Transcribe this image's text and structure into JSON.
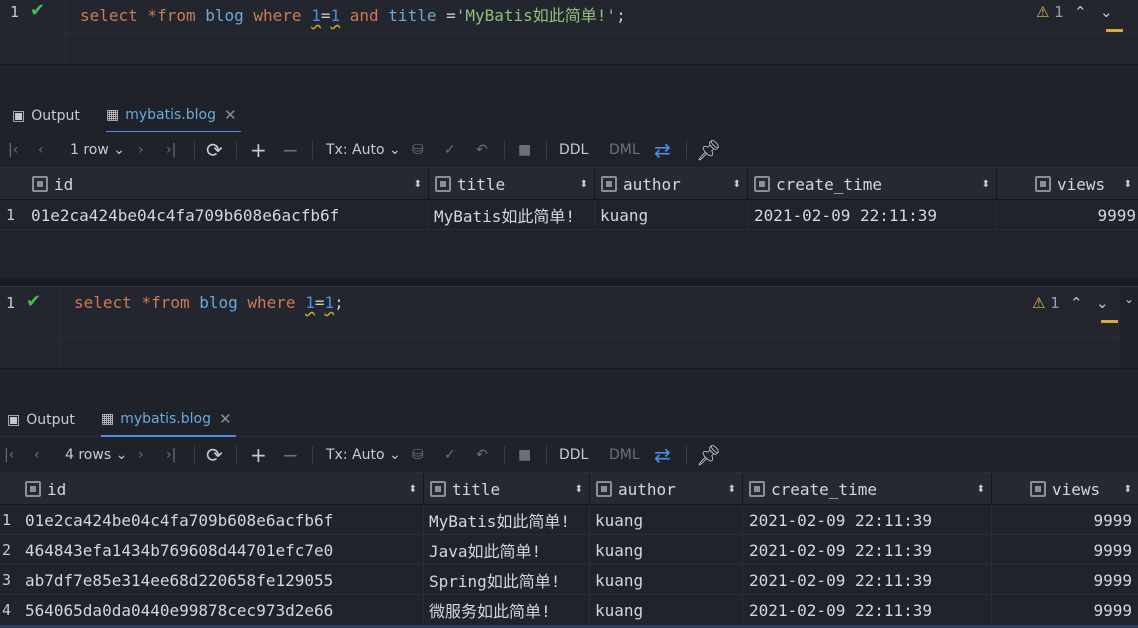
{
  "query1": {
    "line_number": "1",
    "tokens": [
      "select",
      " *from ",
      "blog",
      " where ",
      "1",
      "=",
      "1",
      " and ",
      "title",
      " =",
      "'MyBatis如此简单!'",
      ";"
    ],
    "warning_count": "1"
  },
  "panel1": {
    "tabs": [
      {
        "label": "Output"
      },
      {
        "label": "mybatis.blog"
      }
    ],
    "toolbar": {
      "rows_label": "1 row",
      "tx_label": "Tx: Auto",
      "ddl_label": "DDL",
      "dml_label": "DML"
    },
    "columns": [
      "id",
      "title",
      "author",
      "create_time",
      "views"
    ],
    "rows": [
      {
        "n": "1",
        "id": "01e2ca424be04c4fa709b608e6acfb6f",
        "title": "MyBatis如此简单!",
        "author": "kuang",
        "create_time": "2021-02-09 22:11:39",
        "views": "9999"
      }
    ]
  },
  "query2": {
    "line_number": "1",
    "tokens": [
      "select",
      " *from ",
      "blog",
      " where ",
      "1",
      "=",
      "1",
      ";"
    ],
    "warning_count": "1"
  },
  "panel2": {
    "tabs": [
      {
        "label": "Output"
      },
      {
        "label": "mybatis.blog"
      }
    ],
    "toolbar": {
      "rows_label": "4 rows",
      "tx_label": "Tx: Auto",
      "ddl_label": "DDL",
      "dml_label": "DML"
    },
    "columns": [
      "id",
      "title",
      "author",
      "create_time",
      "views"
    ],
    "rows": [
      {
        "n": "1",
        "id": "01e2ca424be04c4fa709b608e6acfb6f",
        "title": "MyBatis如此简单!",
        "author": "kuang",
        "create_time": "2021-02-09 22:11:39",
        "views": "9999"
      },
      {
        "n": "2",
        "id": "464843efa1434b769608d44701efc7e0",
        "title": "Java如此简单!",
        "author": "kuang",
        "create_time": "2021-02-09 22:11:39",
        "views": "9999"
      },
      {
        "n": "3",
        "id": "ab7df7e85e314ee68d220658fe129055",
        "title": "Spring如此简单!",
        "author": "kuang",
        "create_time": "2021-02-09 22:11:39",
        "views": "9999"
      },
      {
        "n": "4",
        "id": "564065da0da0440e99878cec973d2e66",
        "title": "微服务如此简单!",
        "author": "kuang",
        "create_time": "2021-02-09 22:11:39",
        "views": "9999"
      }
    ]
  },
  "colors": {
    "keyword": "#cc7a52",
    "identifier": "#6aa9dc",
    "number": "#4a8ee6",
    "string": "#8fc07a",
    "success": "#3fbf50",
    "warning": "#e6b84a"
  }
}
